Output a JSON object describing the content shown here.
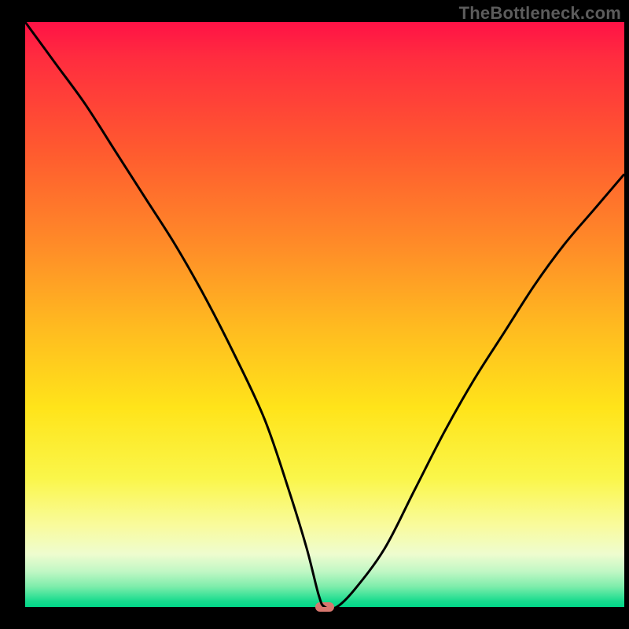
{
  "watermark": "TheBottleneck.com",
  "chart_data": {
    "type": "line",
    "title": "",
    "xlabel": "",
    "ylabel": "",
    "xlim": [
      0,
      100
    ],
    "ylim": [
      0,
      100
    ],
    "grid": false,
    "legend": false,
    "min_marker": {
      "x": 50,
      "y": 0
    },
    "series": [
      {
        "name": "bottleneck-curve",
        "x": [
          0,
          5,
          10,
          15,
          20,
          25,
          30,
          35,
          40,
          44,
          47,
          49,
          50,
          52,
          55,
          60,
          65,
          70,
          75,
          80,
          85,
          90,
          95,
          100
        ],
        "y": [
          100,
          93,
          86,
          78,
          70,
          62,
          53,
          43,
          32,
          20,
          10,
          2,
          0,
          0,
          3,
          10,
          20,
          30,
          39,
          47,
          55,
          62,
          68,
          74
        ]
      }
    ],
    "background_gradient": {
      "direction": "vertical",
      "stops": [
        {
          "pos": 0.0,
          "color": "#ff1246"
        },
        {
          "pos": 0.22,
          "color": "#ff5a2f"
        },
        {
          "pos": 0.52,
          "color": "#ffba20"
        },
        {
          "pos": 0.78,
          "color": "#faf64a"
        },
        {
          "pos": 0.91,
          "color": "#eefccf"
        },
        {
          "pos": 1.0,
          "color": "#00d789"
        }
      ]
    }
  }
}
